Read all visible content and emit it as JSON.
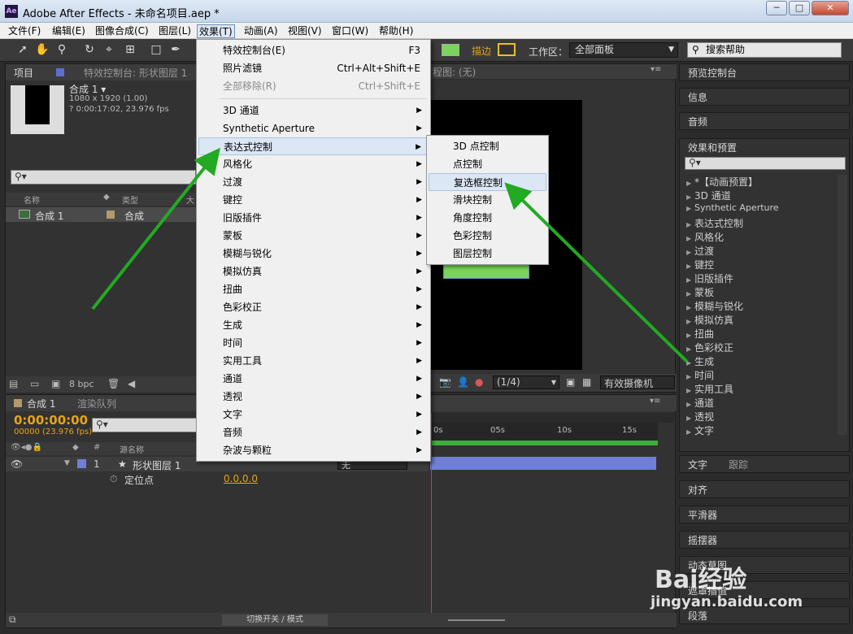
{
  "window": {
    "title": "Adobe After Effects - 未命名项目.aep *",
    "icon": "Ae",
    "minimize": "─",
    "maximize": "□",
    "close": "✕"
  },
  "menubar": [
    {
      "label": "文件(F)"
    },
    {
      "label": "编辑(E)"
    },
    {
      "label": "图像合成(C)"
    },
    {
      "label": "图层(L)"
    },
    {
      "label": "效果(T)"
    },
    {
      "label": "动画(A)"
    },
    {
      "label": "视图(V)"
    },
    {
      "label": "窗口(W)"
    },
    {
      "label": "帮助(H)"
    }
  ],
  "toolbar": {
    "stroke_label": "描边",
    "workspace_label": "工作区：",
    "workspace_value": "全部面板",
    "search_help": "搜索帮助"
  },
  "project_panel": {
    "tab": "项目",
    "effect_controls_tab": "特效控制台: 形状图层 1",
    "comp_name": "合成 1 ▾",
    "comp_size": "1080 x 1920 (1.00)",
    "comp_duration": "? 0:00:17:02, 23.976 fps",
    "col_name": "名称",
    "col_type": "类型",
    "col_size": "大",
    "item_name": "合成 1",
    "item_type": "合成",
    "bpc": "8 bpc"
  },
  "viewer": {
    "flow_tab": "程图: (无)",
    "resolution": "(1/4)",
    "camera": "有效摄像机"
  },
  "effect_menu": {
    "items": [
      {
        "label": "特效控制台(E)",
        "shortcut": "F3"
      },
      {
        "label": "照片滤镜",
        "shortcut": "Ctrl+Alt+Shift+E"
      },
      {
        "label": "全部移除(R)",
        "shortcut": "Ctrl+Shift+E"
      },
      {
        "label": "3D 通道"
      },
      {
        "label": "Synthetic Aperture"
      },
      {
        "label": "表达式控制"
      },
      {
        "label": "风格化"
      },
      {
        "label": "过渡"
      },
      {
        "label": "键控"
      },
      {
        "label": "旧版插件"
      },
      {
        "label": "蒙板"
      },
      {
        "label": "模糊与锐化"
      },
      {
        "label": "模拟仿真"
      },
      {
        "label": "扭曲"
      },
      {
        "label": "色彩校正"
      },
      {
        "label": "生成"
      },
      {
        "label": "时间"
      },
      {
        "label": "实用工具"
      },
      {
        "label": "通道"
      },
      {
        "label": "透视"
      },
      {
        "label": "文字"
      },
      {
        "label": "音频"
      },
      {
        "label": "杂波与颗粒"
      }
    ]
  },
  "expression_submenu": {
    "items": [
      {
        "label": "3D 点控制"
      },
      {
        "label": "点控制"
      },
      {
        "label": "复选框控制"
      },
      {
        "label": "滑块控制"
      },
      {
        "label": "角度控制"
      },
      {
        "label": "色彩控制"
      },
      {
        "label": "图层控制"
      }
    ]
  },
  "right_panels": {
    "preview": "预览控制台",
    "info": "信息",
    "audio": "音频",
    "effects_presets": "效果和预置",
    "effects_list": [
      "*【动画预置】",
      "3D 通道",
      "Synthetic Aperture",
      "表达式控制",
      "风格化",
      "过渡",
      "键控",
      "旧版插件",
      "蒙板",
      "模糊与锐化",
      "模拟仿真",
      "扭曲",
      "色彩校正",
      "生成",
      "时间",
      "实用工具",
      "通道",
      "透视",
      "文字"
    ],
    "text": "文字",
    "tracker": "跟踪",
    "align": "对齐",
    "smoother": "平滑器",
    "wiggler": "摇摆器",
    "motion_sketch": "动态草图",
    "mask_interp": "遮罩插值",
    "paragraph": "段落"
  },
  "timeline": {
    "tab": "合成 1",
    "render_queue": "渲染队列",
    "timecode": "0:00:00:00",
    "frames": "00000 (23.976 fps)",
    "col_source": "源名称",
    "layer_num": "1",
    "layer_name": "形状图层 1",
    "parent": "无",
    "anchor_label": "定位点",
    "anchor_value": "0.0,0.0",
    "ruler": [
      "0s",
      "05s",
      "10s",
      "15s"
    ],
    "toggle_modes": "切换开关 / 模式"
  },
  "watermark": {
    "brand": "Bai经验",
    "url": "jingyan.baidu.com"
  },
  "colors": {
    "accent_arrow": "#22aa22",
    "timecode": "#e8a317",
    "shape_fill": "#7ad45a",
    "layer_bar": "#6f7fd6"
  }
}
